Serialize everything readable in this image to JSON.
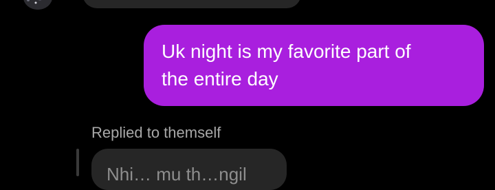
{
  "conversation": {
    "sent_message": {
      "text": "Uk night is my favorite part of\nthe entire day",
      "color": "#a91fde"
    },
    "reply_context": {
      "label": "Replied to themself",
      "quoted_text": "Nhi… mu th…ngil"
    },
    "incoming_bubble_color": "#262626",
    "background": "#000000"
  }
}
